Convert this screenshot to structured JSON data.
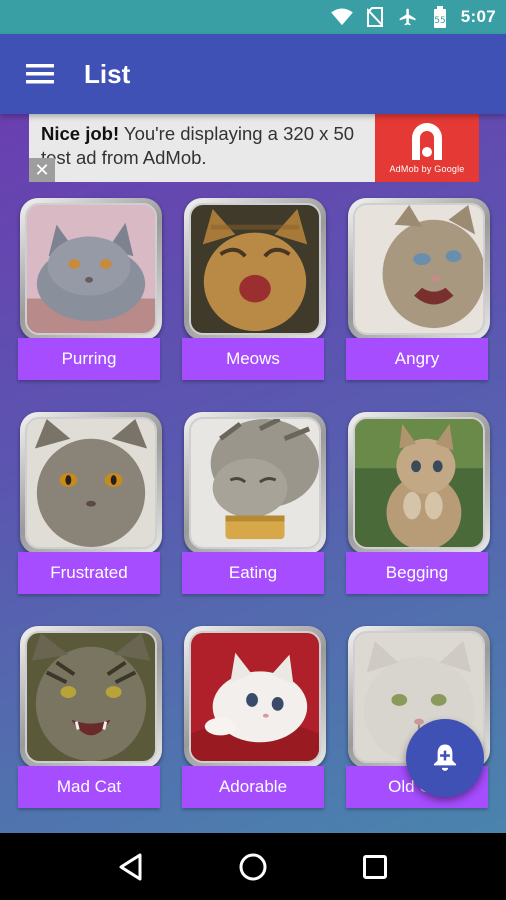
{
  "status_bar": {
    "time": "5:07",
    "icons": [
      "wifi-icon",
      "no-sim-icon",
      "airplane-icon",
      "battery-icon"
    ]
  },
  "app_bar": {
    "title": "List",
    "menu_icon": "hamburger-menu-icon",
    "color": "#3f51b5"
  },
  "ad": {
    "bold_text": "Nice job!",
    "text": " You're displaying a 320 x 50 test ad from AdMob.",
    "close_glyph": "✕",
    "logo_caption": "AdMob by Google",
    "logo_color": "#e53935"
  },
  "tiles": [
    {
      "label": "Purring"
    },
    {
      "label": "Meows"
    },
    {
      "label": "Angry"
    },
    {
      "label": "Frustrated"
    },
    {
      "label": "Eating"
    },
    {
      "label": "Begging"
    },
    {
      "label": "Mad Cat"
    },
    {
      "label": "Adorable"
    },
    {
      "label": "Old Cat"
    }
  ],
  "label_color": "#a64dff",
  "fab": {
    "icon": "add-alarm-bell-icon"
  },
  "nav_bar": {
    "buttons": [
      "back-icon",
      "home-icon",
      "recents-icon"
    ]
  }
}
